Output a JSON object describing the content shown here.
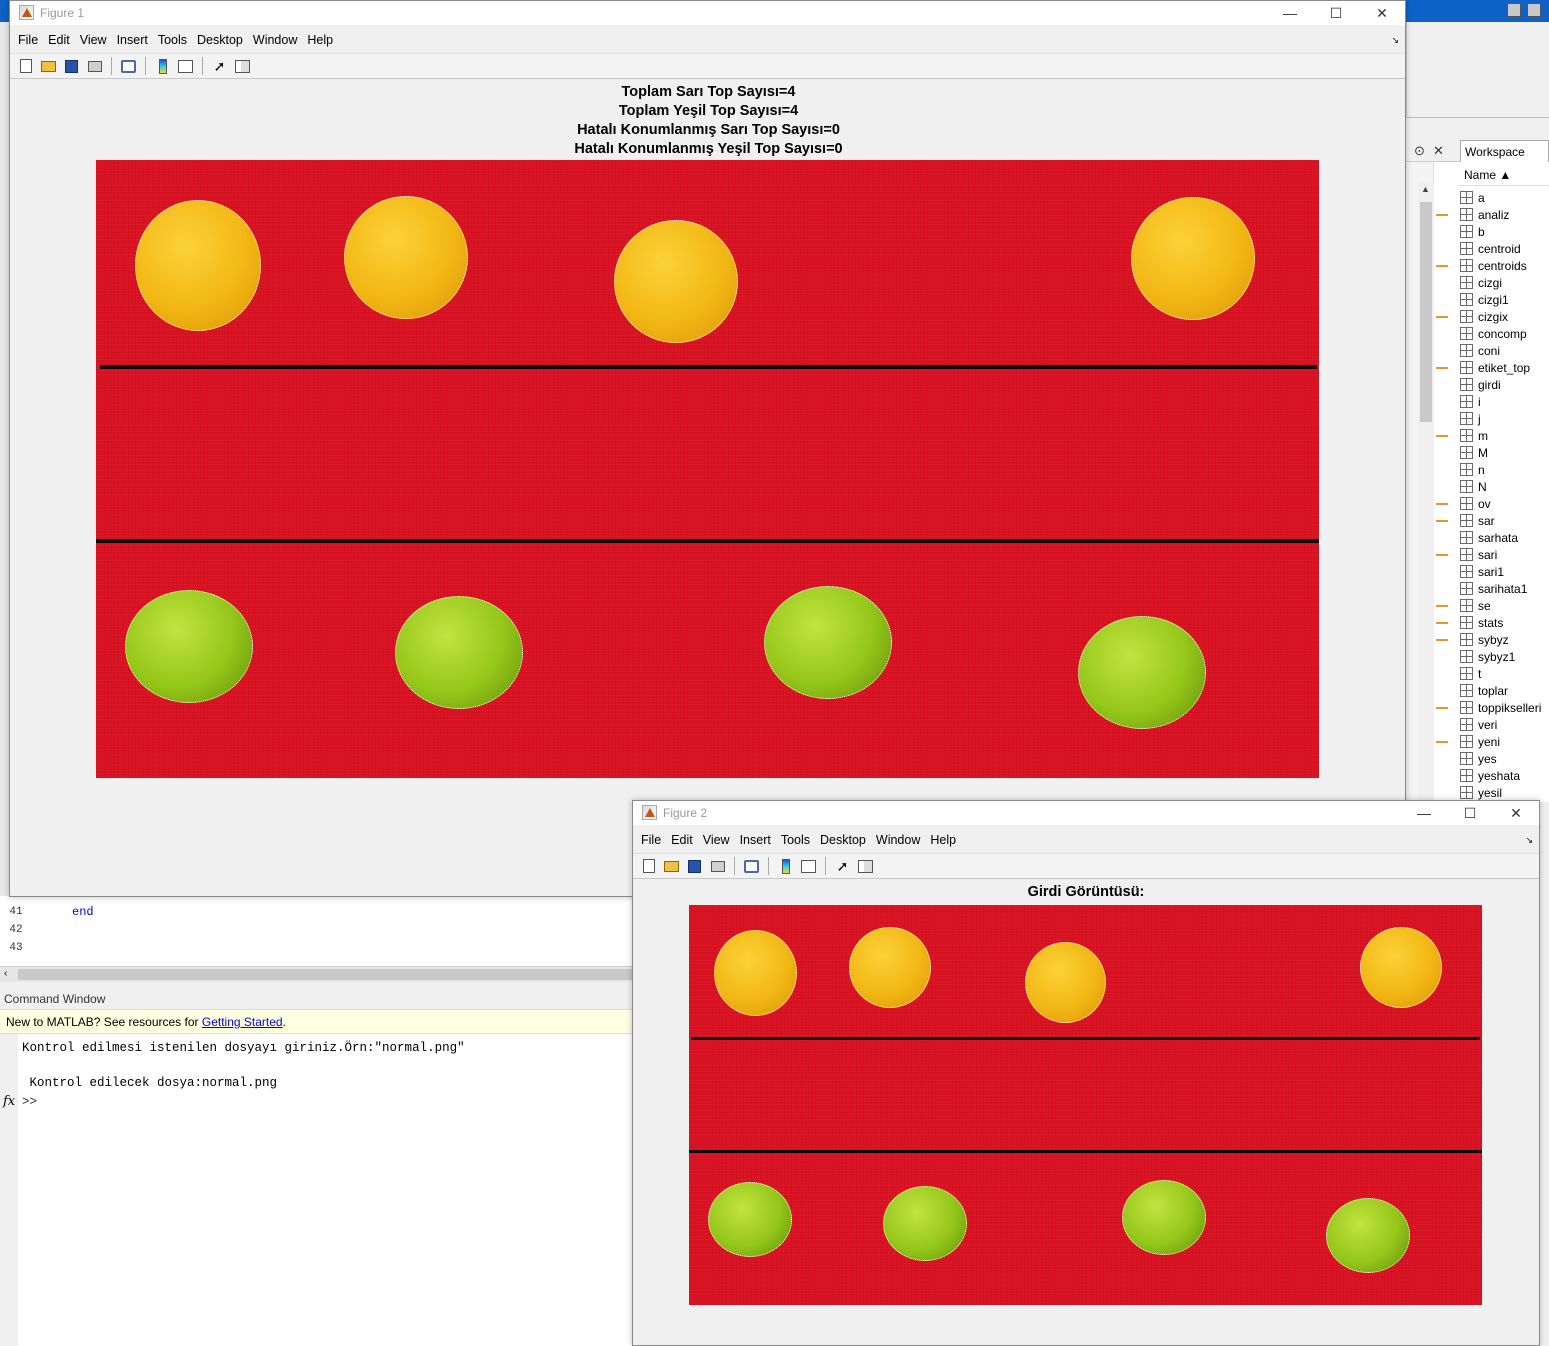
{
  "desktop": {
    "editor_lines": [
      {
        "num": "41",
        "code": "end"
      },
      {
        "num": "42",
        "code": ""
      },
      {
        "num": "43",
        "code": ""
      }
    ],
    "command_window": {
      "title": "Command Window",
      "banner_text": "New to MATLAB? See resources for ",
      "banner_link": "Getting Started",
      "banner_end": ".",
      "lines": [
        "Kontrol edilmesi istenilen dosyayı giriniz.Örn:\"normal.png\"",
        " Kontrol edilecek dosya:normal.png"
      ],
      "prompt": ">>",
      "fx": "fx"
    },
    "workspace": {
      "tab": "Workspace",
      "column": "Name ▲",
      "variables": [
        "a",
        "analiz",
        "b",
        "centroid",
        "centroids",
        "cizgi",
        "cizgi1",
        "cizgix",
        "concomp",
        "coni",
        "etiket_top",
        "girdi",
        "i",
        "j",
        "m",
        "M",
        "n",
        "N",
        "ov",
        "sar",
        "sarhata",
        "sari",
        "sari1",
        "sarihata1",
        "se",
        "stats",
        "sybyz",
        "sybyz1",
        "t",
        "toplar",
        "toppikselleri",
        "veri",
        "yeni",
        "yes",
        "yeshata",
        "yesil"
      ]
    }
  },
  "menus": [
    "File",
    "Edit",
    "View",
    "Insert",
    "Tools",
    "Desktop",
    "Window",
    "Help"
  ],
  "figure1": {
    "title": "Figure 1",
    "axes_title": [
      "Toplam Sarı Top Sayısı=4",
      "Toplam Yeşil Top Sayısı=4",
      "Hatalı Konumlanmış Sarı Top Sayısı=0",
      "Hatalı Konumlanmış Yeşil Top Sayısı=0"
    ]
  },
  "figure2": {
    "title": "Figure 2",
    "axes_title": "Girdi Görüntüsü:"
  },
  "colors": {
    "felt": "#d81020",
    "line": "#0a0a0a",
    "yellow_ball": "#f2b714",
    "green_ball": "#95c61a"
  }
}
